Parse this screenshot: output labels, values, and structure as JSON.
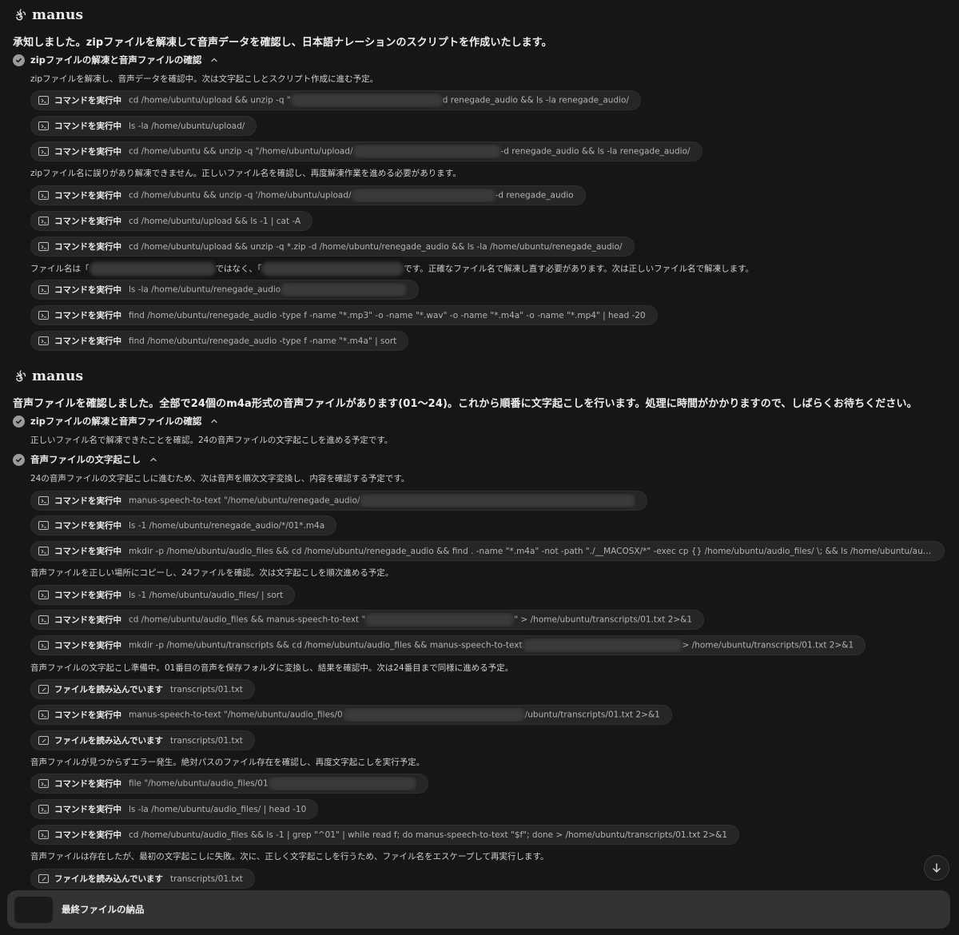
{
  "brand": "manus",
  "messages": [
    {
      "intro": "承知しました。zipファイルを解凍して音声データを確認し、日本語ナレーションのスクリプトを作成いたします。",
      "sections": [
        {
          "title": "zipファイルの解凍と音声ファイルの確認",
          "items": [
            {
              "kind": "note",
              "text": "zipファイルを解凍し、音声データを確認中。次は文字起こしとスクリプト作成に進む予定。"
            },
            {
              "kind": "cmd",
              "label": "コマンドを実行中",
              "parts": [
                "cd /home/ubuntu/upload && unzip -q \"",
                "d renegade_audio && ls -la renegade_audio/"
              ],
              "blur": [
                190
              ]
            },
            {
              "kind": "cmd",
              "label": "コマンドを実行中",
              "parts": [
                "ls -la /home/ubuntu/upload/"
              ]
            },
            {
              "kind": "cmd",
              "label": "コマンドを実行中",
              "parts": [
                "cd /home/ubuntu && unzip -q \"/home/ubuntu/upload/",
                "-d renegade_audio && ls -la renegade_audio/"
              ],
              "blur": [
                185
              ]
            },
            {
              "kind": "note",
              "text": "zipファイル名に誤りがあり解凍できません。正しいファイル名を確認し、再度解凍作業を進める必要があります。"
            },
            {
              "kind": "cmd",
              "label": "コマンドを実行中",
              "parts": [
                "cd /home/ubuntu && unzip -q '/home/ubuntu/upload/",
                "-d renegade_audio"
              ],
              "blur": [
                180
              ]
            },
            {
              "kind": "cmd",
              "label": "コマンドを実行中",
              "parts": [
                "cd /home/ubuntu/upload && ls -1 | cat -A"
              ]
            },
            {
              "kind": "cmd",
              "label": "コマンドを実行中",
              "parts": [
                "cd /home/ubuntu/upload && unzip -q *.zip -d /home/ubuntu/renegade_audio && ls -la /home/ubuntu/renegade_audio/"
              ]
            },
            {
              "kind": "note",
              "parts": [
                "ファイル名は「",
                "ではなく、「",
                "です。正確なファイル名で解凍し直す必要があります。次は正しいファイル名で解凍します。"
              ],
              "blur": [
                158,
                178
              ]
            },
            {
              "kind": "cmd",
              "label": "コマンドを実行中",
              "parts": [
                "ls -la /home/ubuntu/renegade_audio",
                ""
              ],
              "blur": [
                158
              ]
            },
            {
              "kind": "cmd",
              "label": "コマンドを実行中",
              "parts": [
                "find /home/ubuntu/renegade_audio -type f -name \"*.mp3\" -o -name \"*.wav\" -o -name \"*.m4a\" -o -name \"*.mp4\" | head -20"
              ]
            },
            {
              "kind": "cmd",
              "label": "コマンドを実行中",
              "parts": [
                "find /home/ubuntu/renegade_audio -type f -name \"*.m4a\" | sort"
              ]
            }
          ]
        }
      ]
    },
    {
      "intro": "音声ファイルを確認しました。全部で24個のm4a形式の音声ファイルがあります(01～24)。これから順番に文字起こしを行います。処理に時間がかかりますので、しばらくお待ちください。",
      "sections": [
        {
          "title": "zipファイルの解凍と音声ファイルの確認",
          "items": [
            {
              "kind": "note",
              "text": "正しいファイル名で解凍できたことを確認。24の音声ファイルの文字起こしを進める予定です。"
            }
          ]
        },
        {
          "title": "音声ファイルの文字起こし",
          "items": [
            {
              "kind": "note",
              "text": "24の音声ファイルの文字起こしに進むため、次は音声を順次文字変換し、内容を確認する予定です。"
            },
            {
              "kind": "cmd",
              "label": "コマンドを実行中",
              "parts": [
                "manus-speech-to-text \"/home/ubuntu/renegade_audio/",
                ""
              ],
              "blur": [
                345
              ]
            },
            {
              "kind": "cmd",
              "label": "コマンドを実行中",
              "parts": [
                "ls -1 /home/ubuntu/renegade_audio/*/01*.m4a"
              ]
            },
            {
              "kind": "cmd",
              "label": "コマンドを実行中",
              "parts": [
                "mkdir -p /home/ubuntu/audio_files && cd /home/ubuntu/renegade_audio && find . -name \"*.m4a\" -not -path \"./__MACOSX/*\" -exec cp {} /home/ubuntu/audio_files/ \\; && ls /home/ubuntu/audio_files/"
              ]
            },
            {
              "kind": "note",
              "text": "音声ファイルを正しい場所にコピーし、24ファイルを確認。次は文字起こしを順次進める予定。"
            },
            {
              "kind": "cmd",
              "label": "コマンドを実行中",
              "parts": [
                "ls -1 /home/ubuntu/audio_files/ | sort"
              ]
            },
            {
              "kind": "cmd",
              "label": "コマンドを実行中",
              "parts": [
                "cd /home/ubuntu/audio_files && manus-speech-to-text \"",
                "\" > /home/ubuntu/transcripts/01.txt 2>&1"
              ],
              "blur": [
                186
              ]
            },
            {
              "kind": "cmd",
              "label": "コマンドを実行中",
              "parts": [
                "mkdir -p /home/ubuntu/transcripts && cd /home/ubuntu/audio_files && manus-speech-to-text",
                "> /home/ubuntu/transcripts/01.txt 2>&1"
              ],
              "blur": [
                200
              ]
            },
            {
              "kind": "note",
              "text": "音声ファイルの文字起こし準備中。01番目の音声を保存フォルダに変換し、結果を確認中。次は24番目まで同様に進める予定。"
            },
            {
              "kind": "read",
              "label": "ファイルを読み込んでいます",
              "parts": [
                "transcripts/01.txt"
              ]
            },
            {
              "kind": "cmd",
              "label": "コマンドを実行中",
              "parts": [
                "manus-speech-to-text \"/home/ubuntu/audio_files/0",
                "/ubuntu/transcripts/01.txt 2>&1"
              ],
              "blur": [
                228
              ]
            },
            {
              "kind": "read",
              "label": "ファイルを読み込んでいます",
              "parts": [
                "transcripts/01.txt"
              ]
            },
            {
              "kind": "note",
              "text": "音声ファイルが見つからずエラー発生。絶対パスのファイル存在を確認し、再度文字起こしを実行予定。"
            },
            {
              "kind": "cmd",
              "label": "コマンドを実行中",
              "parts": [
                "file \"/home/ubuntu/audio_files/01",
                ""
              ],
              "blur": [
                185
              ]
            },
            {
              "kind": "cmd",
              "label": "コマンドを実行中",
              "parts": [
                "ls -la /home/ubuntu/audio_files/ | head -10"
              ]
            },
            {
              "kind": "cmd",
              "label": "コマンドを実行中",
              "parts": [
                "cd /home/ubuntu/audio_files && ls -1 | grep \"^01\" | while read f; do manus-speech-to-text \"$f\"; done > /home/ubuntu/transcripts/01.txt 2>&1"
              ]
            },
            {
              "kind": "note",
              "text": "音声ファイルは存在したが、最初の文字起こしに失敗。次に、正しく文字起こしを行うため、ファイル名をエスケープして再実行します。"
            },
            {
              "kind": "read",
              "label": "ファイルを読み込んでいます",
              "parts": [
                "transcripts/01.txt"
              ]
            }
          ]
        }
      ]
    }
  ],
  "bottom_bar": {
    "label": "最終ファイルの納品"
  },
  "icons": {
    "logo": "manus-logo-icon",
    "check": "check-circle-icon",
    "chevron": "chevron-up-icon",
    "terminal": "terminal-icon",
    "file": "file-edit-icon",
    "scroll": "arrow-down-icon"
  },
  "colors": {
    "background": "#161616",
    "pill": "#262626",
    "bottom_bar": "#333333"
  }
}
